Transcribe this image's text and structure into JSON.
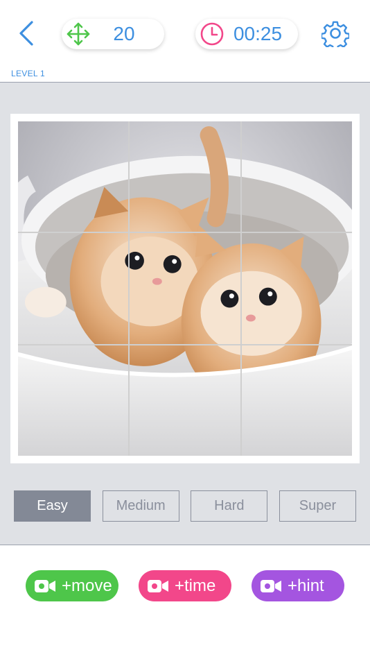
{
  "header": {
    "back_icon": "chevron-left-icon",
    "moves": {
      "icon": "move-arrows-icon",
      "value": "20"
    },
    "timer": {
      "icon": "clock-icon",
      "value": "00:25"
    },
    "settings_icon": "gear-icon",
    "level_label": "LEVEL 1"
  },
  "board": {
    "grid_size": 3,
    "image": "kittens-in-teacup"
  },
  "difficulty": {
    "options": [
      "Easy",
      "Medium",
      "Hard",
      "Super"
    ],
    "selected": "Easy"
  },
  "actions": [
    {
      "label": "+move",
      "icon": "video-camera-icon",
      "color": "#4ec64a"
    },
    {
      "label": "+time",
      "icon": "video-camera-icon",
      "color": "#f2478a"
    },
    {
      "label": "+hint",
      "icon": "video-camera-icon",
      "color": "#a455e0"
    }
  ],
  "colors": {
    "accent_blue": "#3d8fe0",
    "move_green": "#4ec64a",
    "timer_pink": "#f2478a",
    "hint_purple": "#a455e0",
    "board_background": "#dfe1e5"
  }
}
